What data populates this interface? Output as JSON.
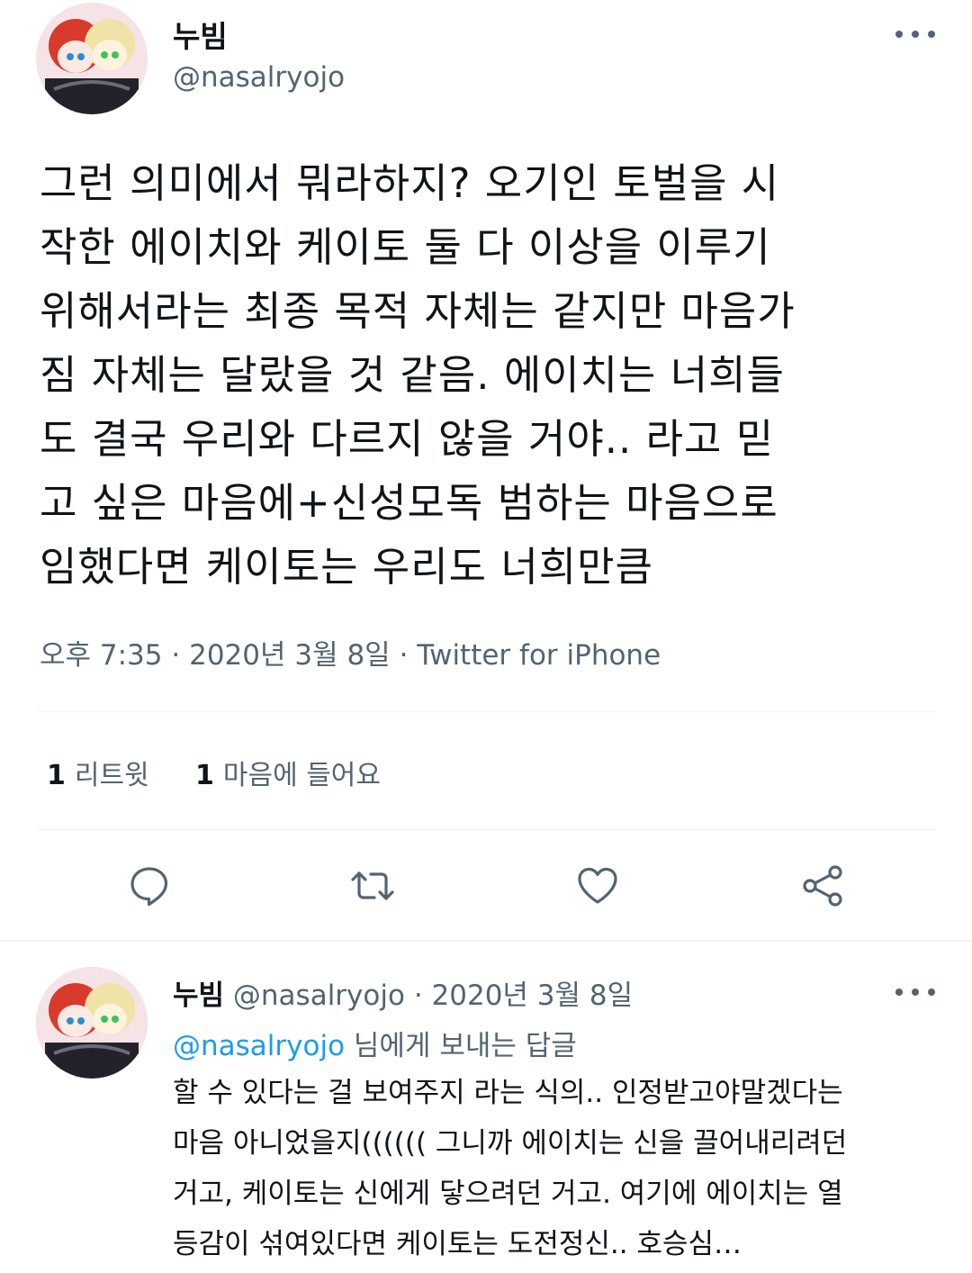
{
  "main_tweet": {
    "author": {
      "name": "누빔",
      "handle": "@nasalryojo"
    },
    "text_lines": [
      "그런 의미에서 뭐라하지? 오기인 토벌을 시",
      "작한 에이치와 케이토 둘 다 이상을 이루기",
      "위해서라는 최종 목적 자체는 같지만 마음가",
      "짐 자체는 달랐을 것 같음. 에이치는 너희들",
      "도 결국 우리와 다르지 않을 거야.. 라고 믿",
      "고 싶은 마음에+신성모독 범하는 마음으로",
      "임했다면 케이토는 우리도 너희만큼"
    ],
    "time": "오후 7:35",
    "date": "2020년 3월 8일",
    "source": "Twitter for iPhone",
    "separator": "·",
    "stats": {
      "retweets_count": "1",
      "retweets_label": "리트윗",
      "likes_count": "1",
      "likes_label": "마음에 들어요"
    },
    "actions": [
      "reply",
      "retweet",
      "like",
      "share"
    ]
  },
  "reply_tweet": {
    "author": {
      "name": "누빔",
      "handle": "@nasalryojo"
    },
    "separator": "·",
    "date": "2020년 3월 8일",
    "replying_to": {
      "mention": "@nasalryojo",
      "suffix": " 님에게 보내는 답글"
    },
    "text_lines": [
      "할 수 있다는 걸 보여주지 라는 식의.. 인정받고야말겠다는",
      "마음 아니었을지(((((( 그니까 에이치는 신을 끌어내리려던",
      "거고, 케이토는 신에게 닿으려던 거고. 여기에 에이치는 열",
      "등감이 섞여있다면 케이토는 도전정신.. 호승심…"
    ]
  },
  "colors": {
    "text": "#0f1419",
    "secondary": "#536471",
    "accent": "#1d9bf0",
    "divider": "#eff3f4"
  }
}
